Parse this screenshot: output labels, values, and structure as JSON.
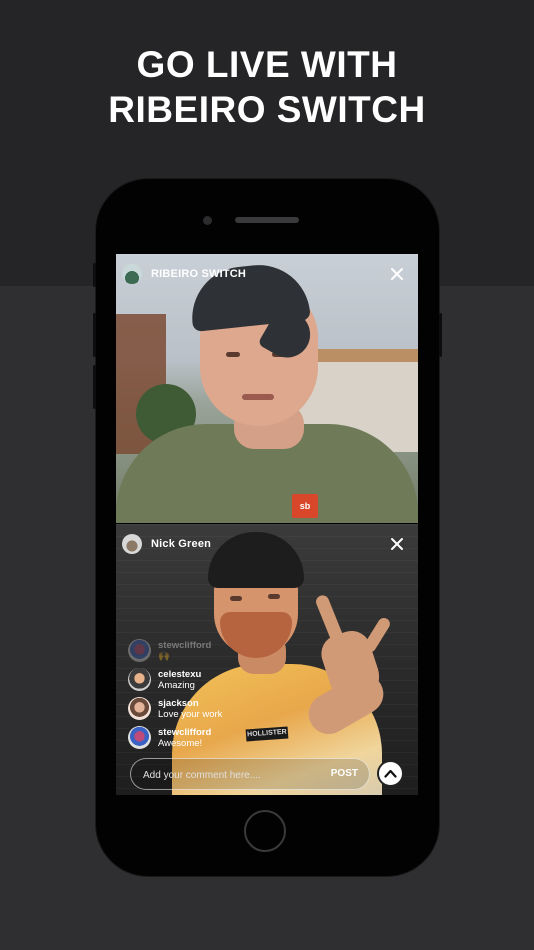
{
  "headline": {
    "line1": "GO LIVE WITH",
    "line2": "RIBEIRO SWITCH"
  },
  "host": {
    "name": "RIBEIRO SWITCH"
  },
  "guest": {
    "name": "Nick Green"
  },
  "video_text": {
    "shirt_logo": "sb",
    "shirt_label": "HOLLISTER"
  },
  "comments": [
    {
      "user": "stewclifford",
      "message": "🙌"
    },
    {
      "user": "celestexu",
      "message": "Amazing"
    },
    {
      "user": "sjackson",
      "message": "Love your work"
    },
    {
      "user": "stewclifford",
      "message": "Awesome!"
    }
  ],
  "comment_bar": {
    "placeholder": "Add your comment here....",
    "post_label": "POST"
  },
  "colors": {
    "background": "#2f2f31",
    "top_band": "#252527",
    "phone": "#020202",
    "text": "#ffffff"
  },
  "icons": {
    "close": "close-icon",
    "up": "chevron-up-icon"
  }
}
